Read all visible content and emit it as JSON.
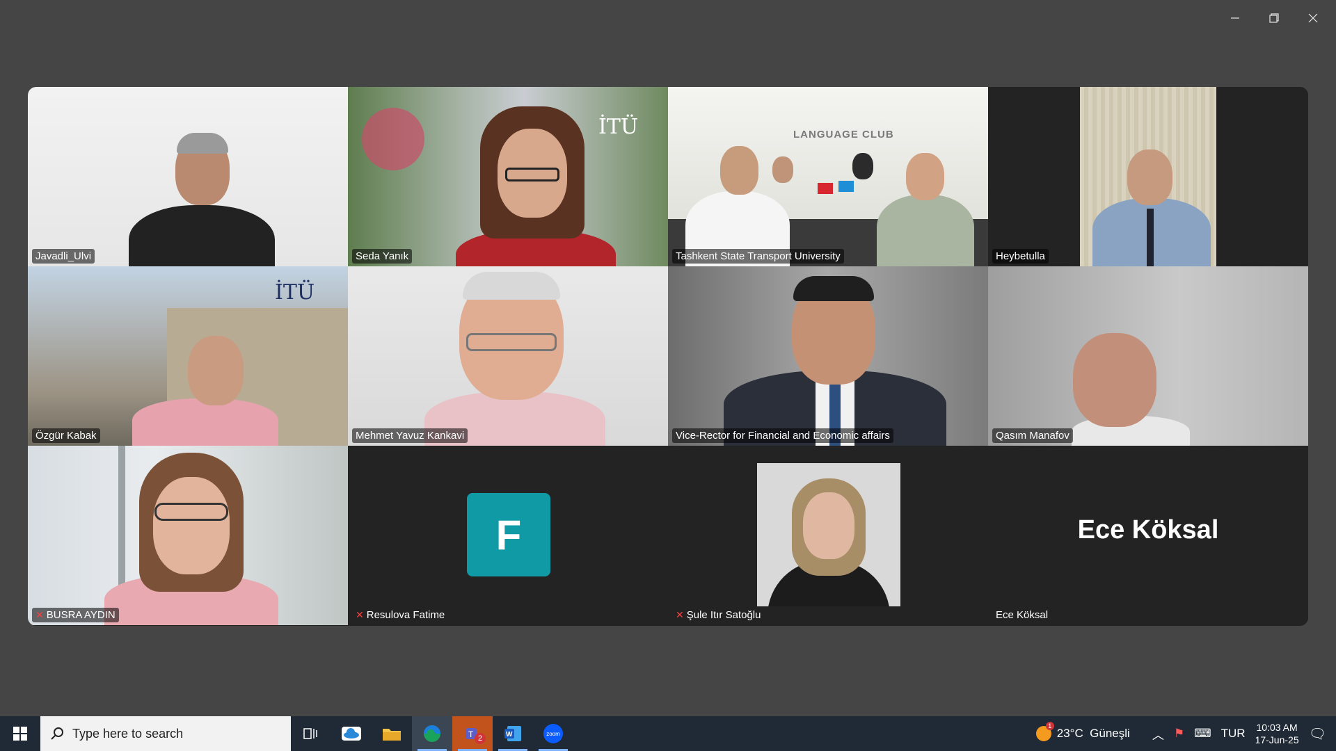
{
  "participants": [
    {
      "name": "Javadli_Ulvi",
      "muted": false
    },
    {
      "name": "Seda Yanık",
      "muted": false,
      "bg_text": "İTÜ"
    },
    {
      "name": "Tashkent State Transport University",
      "muted": false,
      "speaking": true,
      "bg_text": "LANGUAGE CLUB"
    },
    {
      "name": "Heybetulla",
      "muted": false
    },
    {
      "name": "Özgür Kabak",
      "muted": false,
      "bg_text": "İTÜ"
    },
    {
      "name": "Mehmet Yavuz Kankavi",
      "muted": false
    },
    {
      "name": "Vice-Rector for Financial and Economic affairs",
      "muted": false
    },
    {
      "name": "Qasım Manafov",
      "muted": false
    },
    {
      "name": "BUSRA AYDIN",
      "muted": true
    },
    {
      "name": "Resulova Fatime",
      "muted": true,
      "avatar_letter": "F"
    },
    {
      "name": "Şule Itır Satoğlu",
      "muted": true
    },
    {
      "name": "Ece Köksal",
      "muted": false,
      "display_name": "Ece Köksal"
    }
  ],
  "taskbar": {
    "search_placeholder": "Type here to search",
    "teams_badge": "2",
    "zoom_label": "zoom",
    "weather": "23°C  Güneşli",
    "weather_badge": "1",
    "language": "TUR",
    "time": "10:03 AM",
    "date": "17-Jun-25"
  },
  "colors": {
    "active_speaker": "#24d67a",
    "avatar_bg": "#0f9aa6",
    "taskbar_bg": "#1f2a36"
  }
}
